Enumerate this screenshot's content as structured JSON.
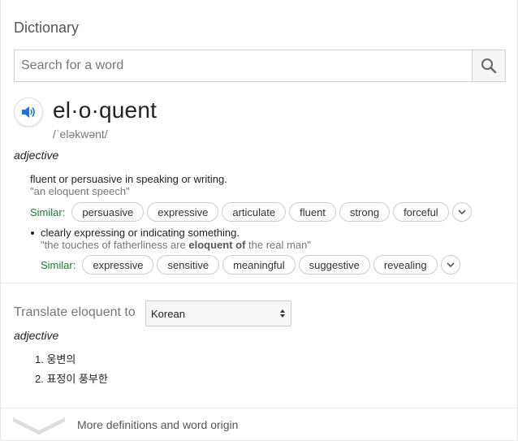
{
  "app": {
    "title": "Dictionary"
  },
  "search": {
    "placeholder": "Search for a word",
    "icon": "search-icon"
  },
  "entry": {
    "word": "el·o·quent",
    "phonetic": "/ˈeləkwənt/",
    "part_of_speech": "adjective",
    "senses": [
      {
        "definition": "fluent or persuasive in speaking or writing.",
        "example": "\"an eloquent speech\"",
        "similar_label": "Similar:",
        "similar": [
          "persuasive",
          "expressive",
          "articulate",
          "fluent",
          "strong",
          "forceful"
        ]
      },
      {
        "definition": "clearly expressing or indicating something.",
        "example_pre": "\"the touches of fatherliness are ",
        "example_bold": "eloquent of",
        "example_post": " the real man\"",
        "similar_label": "Similar:",
        "similar": [
          "expressive",
          "sensitive",
          "meaningful",
          "suggestive",
          "revealing"
        ]
      }
    ]
  },
  "translate": {
    "label": "Translate eloquent to",
    "language": "Korean",
    "part_of_speech": "adjective",
    "items": [
      "1. 웅변의",
      "2. 표정이 풍부한"
    ]
  },
  "footer": {
    "more_label": "More definitions and word origin"
  },
  "colors": {
    "accent": "#1a73e8",
    "similar": "#1e7b34",
    "muted": "#777777"
  }
}
